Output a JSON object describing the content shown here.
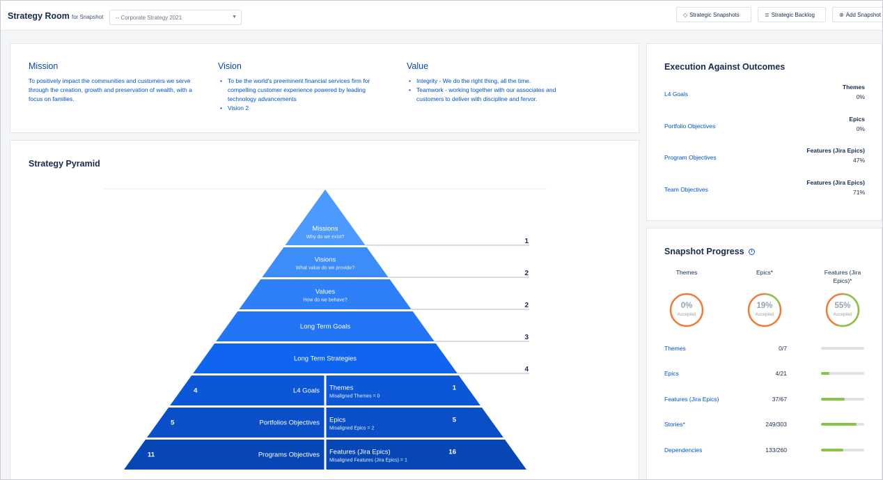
{
  "header": {
    "title": "Strategy Room",
    "for_label": "for Snapshot",
    "snapshot_selected": "-- Corporate Strategy 2021",
    "buttons": {
      "strategic_snapshots": "Strategic Snapshots",
      "strategic_backlog": "Strategic Backlog",
      "add_snapshot": "Add Snapshot"
    }
  },
  "mvv": {
    "mission": {
      "title": "Mission",
      "text": "To positively impact the communities and customers we serve through the creation, growth and preservation of wealth, with a focus on families."
    },
    "vision": {
      "title": "Vision",
      "items": [
        "To be the world's preeminent financial services firm for compelling customer experience powered by leading technology advancements",
        "Vision 2"
      ]
    },
    "value": {
      "title": "Value",
      "items": [
        "Integrity - We do the right thing, all the time.",
        "Teamwork - working together with our associates and customers to deliver with discipline and fervor."
      ]
    }
  },
  "pyramid": {
    "title": "Strategy Pyramid",
    "tiers": [
      {
        "label": "Missions",
        "sub": "Why do we exist?",
        "count": "1"
      },
      {
        "label": "Visions",
        "sub": "What value do we provide?",
        "count": "2"
      },
      {
        "label": "Values",
        "sub": "How do we behave?",
        "count": "2"
      },
      {
        "label": "Long Term Goals",
        "sub": "",
        "count": "3"
      },
      {
        "label": "Long Term Strategies",
        "sub": "",
        "count": "4"
      }
    ],
    "split_rows": [
      {
        "left_count": "4",
        "left_label": "L4 Goals",
        "right_label": "Themes",
        "right_sub": "Misaligned Themes = 0",
        "right_count": "1"
      },
      {
        "left_count": "5",
        "left_label": "Portfolios Objectives",
        "right_label": "Epics",
        "right_sub": "Misaligned Epics = 2",
        "right_count": "5"
      },
      {
        "left_count": "11",
        "left_label": "Programs Objectives",
        "right_label": "Features (Jira Epics)",
        "right_sub": "Misaligned Features (Jira Epics) = 1",
        "right_count": "16"
      }
    ]
  },
  "execution": {
    "title": "Execution Against Outcomes",
    "rows": [
      {
        "label": "L4 Goals",
        "type": "Themes",
        "percent": "0%"
      },
      {
        "label": "Portfolio Objectives",
        "type": "Epics",
        "percent": "0%"
      },
      {
        "label": "Program Objectives",
        "type": "Features (Jira Epics)",
        "percent": "47%"
      },
      {
        "label": "Team Objectives",
        "type": "Features (Jira Epics)",
        "percent": "71%"
      }
    ]
  },
  "progress": {
    "title": "Snapshot Progress",
    "rings": [
      {
        "head": "Themes",
        "percent": "0%",
        "caption": "Accepted",
        "fraction": 0.0
      },
      {
        "head": "Epics*",
        "percent": "19%",
        "caption": "Accepted",
        "fraction": 0.19
      },
      {
        "head": "Features (Jira Epics)*",
        "percent": "55%",
        "caption": "Accepted",
        "fraction": 0.55
      }
    ],
    "rows": [
      {
        "label": "Themes",
        "value": "0/7",
        "fraction": 0.0
      },
      {
        "label": "Epics",
        "value": "4/21",
        "fraction": 0.19
      },
      {
        "label": "Features (Jira Epics)",
        "value": "37/67",
        "fraction": 0.55
      },
      {
        "label": "Stories*",
        "value": "249/303",
        "fraction": 0.82
      },
      {
        "label": "Dependencies",
        "value": "133/260",
        "fraction": 0.51
      }
    ]
  },
  "colors": {
    "accent": "#0052cc",
    "ring_orange": "#f07c3a",
    "ring_green": "#8bc34a",
    "ring_track": "#dfe1e6"
  },
  "icons": {
    "strategic_snapshots": "diamond-icon",
    "strategic_backlog": "backlog-icon",
    "add_snapshot": "add-icon",
    "info": "info-icon"
  }
}
